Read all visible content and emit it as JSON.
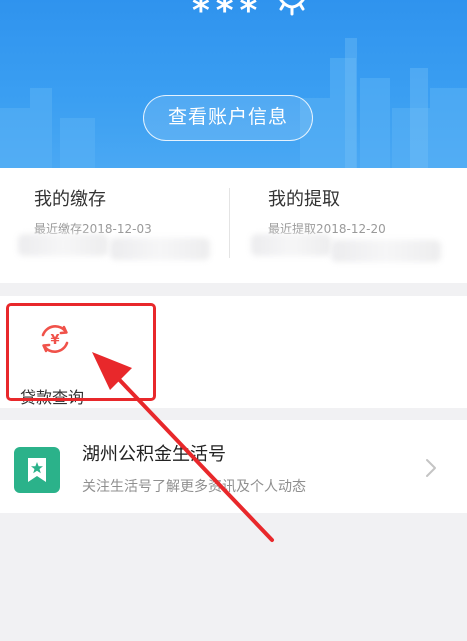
{
  "header": {
    "masked_name": "***",
    "view_account_button": "查看账户信息",
    "eye_icon": "eye-icon"
  },
  "stats": {
    "deposit": {
      "title": "我的缴存",
      "subtitle": "最近缴存2018-12-03"
    },
    "withdraw": {
      "title": "我的提取",
      "subtitle": "最近提取2018-12-20"
    }
  },
  "loan": {
    "label": "贷款查询",
    "icon": "yuan-refresh-icon"
  },
  "service": {
    "title": "湖州公积金生活号",
    "subtitle": "关注生活号了解更多资讯及个人动态",
    "icon": "bookmark-star-icon",
    "chevron": "chevron-right-icon"
  },
  "colors": {
    "header_blue": "#3399f0",
    "highlight_red": "#e8282b",
    "icon_green": "#2bb28a",
    "loan_icon_red": "#f0524a"
  }
}
